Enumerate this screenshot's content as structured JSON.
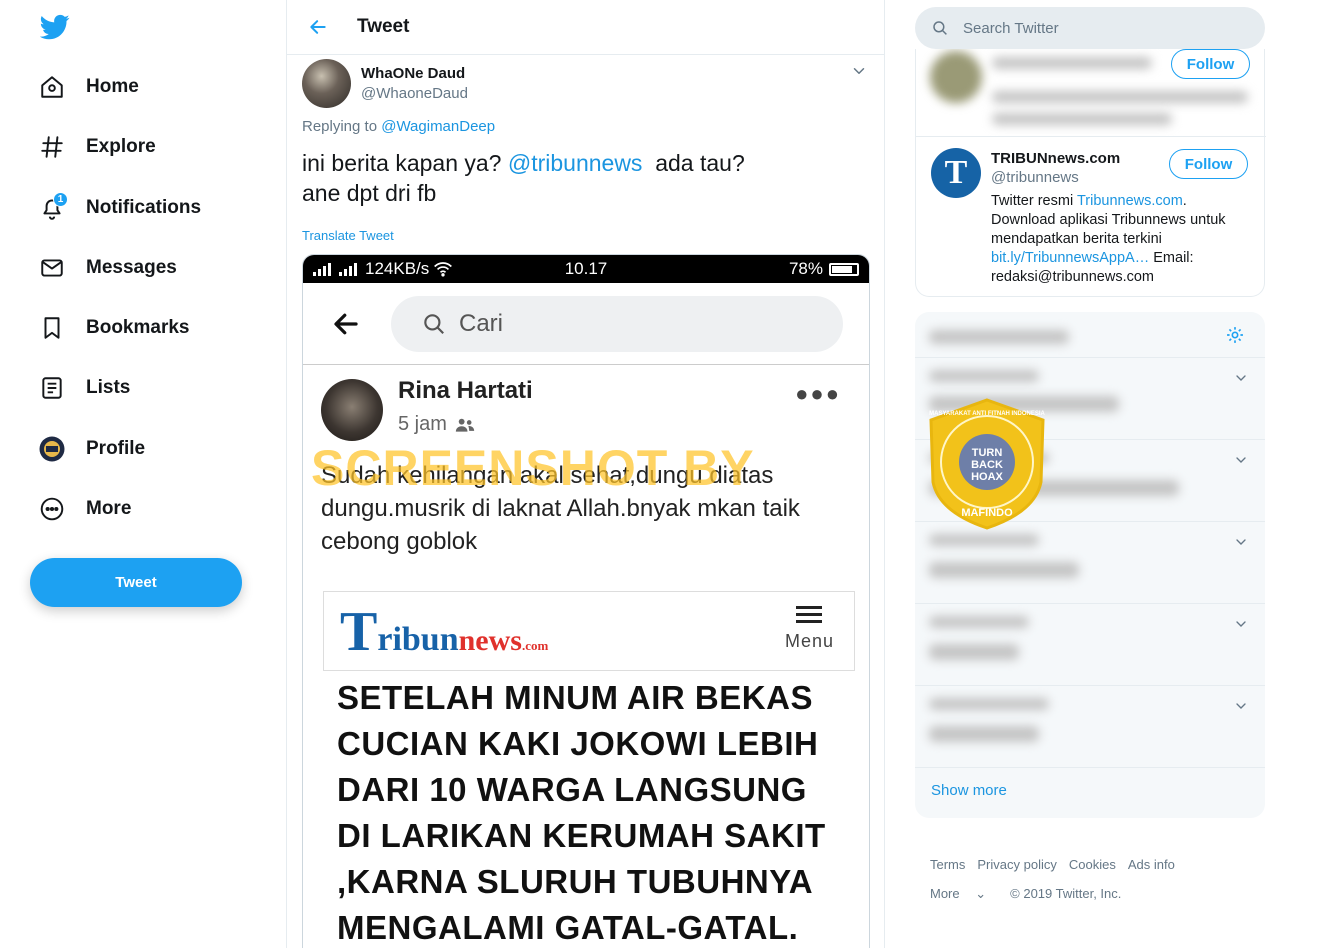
{
  "nav": {
    "items": [
      {
        "label": "Home",
        "icon": "home-icon"
      },
      {
        "label": "Explore",
        "icon": "hashtag-icon"
      },
      {
        "label": "Notifications",
        "icon": "bell-icon",
        "badge": "1"
      },
      {
        "label": "Messages",
        "icon": "envelope-icon"
      },
      {
        "label": "Bookmarks",
        "icon": "bookmark-icon"
      },
      {
        "label": "Lists",
        "icon": "list-icon"
      },
      {
        "label": "Profile",
        "icon": "avatar-icon"
      },
      {
        "label": "More",
        "icon": "more-icon"
      }
    ],
    "tweet_button": "Tweet"
  },
  "header": {
    "title": "Tweet"
  },
  "tweet": {
    "author_name": "WhaONe Daud",
    "author_handle": "@WhaoneDaud",
    "replying_prefix": "Replying to ",
    "replying_to": "@WagimanDeep",
    "text_line1_start": "ini berita kapan ya? ",
    "text_mention": "@tribunnews",
    "text_line1_end": "  ada tau?",
    "text_line2": "ane dpt dri fb",
    "translate": "Translate Tweet"
  },
  "screenshot": {
    "status_network": "124KB/s",
    "status_time": "10.17",
    "status_battery": "78%",
    "search_placeholder": "Cari",
    "post_author": "Rina Hartati",
    "post_time": "5 jam",
    "post_text": "Sudah kehilangan akal sehat,dungu diatas dungu.musrik di laknat Allah.bnyak mkan taik cebong goblok",
    "watermark": "SCREENSHOT BY",
    "tribun_logo_T": "T",
    "tribun_logo_rest": "ribun",
    "tribun_logo_news": "news",
    "tribun_logo_com": ".com",
    "menu_label": "Menu",
    "headline": "SETELAH MINUM AIR BEKAS CUCIAN KAKI JOKOWI LEBIH DARI 10 WARGA LANGSUNG DI LARIKAN KERUMAH SAKIT ,KARNA SLURUH TUBUHNYA MENGALAMI GATAL-GATAL."
  },
  "right": {
    "search_placeholder": "Search Twitter",
    "follow_label": "Follow",
    "suggest": {
      "name": "TRIBUNnews.com",
      "handle": "@tribunnews",
      "bio_start": "Twitter resmi ",
      "bio_link1": "Tribunnews.com",
      "bio_mid": ". Download aplikasi Tribunnews untuk mendapatkan berita terkini ",
      "bio_link2": "bit.ly/TribunnewsAppA…",
      "bio_end": " Email: redaksi@tribunnews.com"
    },
    "show_more": "Show more",
    "badge_text_top": "MASYARAKAT ANTI FITNAH INDONESIA",
    "badge_text_center": "TURN BACK HOAX",
    "badge_text_bottom": "MAFINDO"
  },
  "footer": {
    "links": [
      "Terms",
      "Privacy policy",
      "Cookies",
      "Ads info"
    ],
    "more": "More",
    "copyright": "© 2019 Twitter, Inc."
  },
  "colors": {
    "accent": "#1da1f2",
    "link": "#1b95e0",
    "muted": "#657786",
    "badge_gold": "#f2c21a"
  }
}
